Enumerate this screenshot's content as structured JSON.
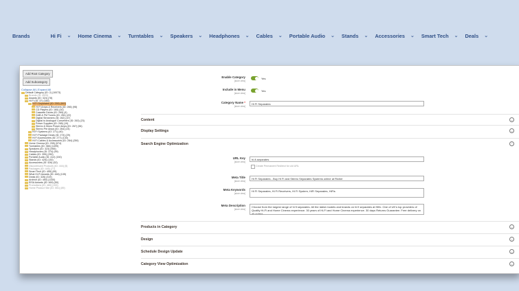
{
  "nav": [
    "Brands",
    "Hi Fi",
    "Home Cinema",
    "Turntables",
    "Speakers",
    "Headphones",
    "Cables",
    "Portable Audio",
    "Stands",
    "Accessories",
    "Smart Tech",
    "Deals"
  ],
  "buttons": {
    "add_root": "Add Root Category",
    "add_sub": "Add Subcategory"
  },
  "tree": {
    "root": "Collapse All | Expand All",
    "nodes": [
      {
        "t": "Default Category (ID: 2) (10073)",
        "lvl": 0
      },
      {
        "t": "Brands (ID: 4525)",
        "lvl": 1,
        "dim": true
      },
      {
        "t": "Awards (ID: 324) (78)",
        "lvl": 1
      },
      {
        "t": "Hi Fi (ID: 37) (346)",
        "lvl": 1
      },
      {
        "t": "Hi Fi Separates (ID: 259) (502)",
        "lvl": 2,
        "sel": true
      },
      {
        "t": "Hi Fi Amps & Receivers (ID: 266) (98)",
        "lvl": 3
      },
      {
        "t": "CD Players (ID: 160) (30)",
        "lvl": 3
      },
      {
        "t": "Cassette Decks (ID: 269) (4)",
        "lvl": 3
      },
      {
        "t": "DAB & FM Tuners (ID: 261) (22)",
        "lvl": 3
      },
      {
        "t": "Digital Streamers (ID: 262) (47)",
        "lvl": 3
      },
      {
        "t": "Digital to Analogue Converters (ID: 263) (23)",
        "lvl": 3
      },
      {
        "t": "Power Supplies (ID: 265) (19)",
        "lvl": 3
      },
      {
        "t": "Stereo & Mono Power Amps (ID: 267) (56)",
        "lvl": 3
      },
      {
        "t": "Stereo Pre Amps (ID: 264) (24)",
        "lvl": 3
      },
      {
        "t": "Hi Fi Systems (ID: 271) (40)",
        "lvl": 2
      },
      {
        "t": "Hi Fi Package Deals (ID: 274) (29)",
        "lvl": 2
      },
      {
        "t": "Hi Fi Accessories (ID: 277) (130)",
        "lvl": 2
      },
      {
        "t": "Hi Fi Cables & Accessories (ID: 284) (250)",
        "lvl": 2
      },
      {
        "t": "Home Cinema (ID: 295) (574)",
        "lvl": 1
      },
      {
        "t": "Turntables (ID: 366) (1499)",
        "lvl": 1
      },
      {
        "t": "Speakers (ID: 323) (955)",
        "lvl": 1
      },
      {
        "t": "Headphones (ID: 374) (99)",
        "lvl": 1
      },
      {
        "t": "Cables (ID: 399) (250)",
        "lvl": 1
      },
      {
        "t": "Portable Audio (ID: 412) (150)",
        "lvl": 1
      },
      {
        "t": "Stands (ID: 425) (130)",
        "lvl": 1
      },
      {
        "t": "Accessories (ID: 426) (52)",
        "lvl": 1
      },
      {
        "t": "Discontinued Products (ID: 444) (5)",
        "lvl": 1,
        "dim": true
      },
      {
        "t": "Packages (ID: 445) (77)",
        "lvl": 1,
        "dim": true
      },
      {
        "t": "Smart Tech (ID: 455) (99)",
        "lvl": 1
      },
      {
        "t": "What Hi-Fi Awards (ID: 446) (135)",
        "lvl": 1
      },
      {
        "t": "Deals (ID: 326) (319)",
        "lvl": 1
      },
      {
        "t": "Archive (ID: 450) (1330)",
        "lvl": 1
      },
      {
        "t": "EISA Awards (ID: 469) (50)",
        "lvl": 1
      },
      {
        "t": "Promotions (ID: 480) (153)",
        "lvl": 1,
        "dim": true
      },
      {
        "t": "Home Product Site (ID: 551) (89)",
        "lvl": 1,
        "dim": true
      }
    ]
  },
  "form": {
    "scope": "[store view]",
    "enable_label": "Enable Category",
    "enable_value": "Yes",
    "menu_label": "Include in Menu",
    "menu_value": "Yes",
    "name_label": "Category Name",
    "name_req": "*",
    "name_value": "Hi Fi Separates",
    "url_label": "URL Key",
    "url_value": "hi-fi-separates",
    "redirect_label": "Create Permanent Redirect for old URL",
    "meta_title_label": "Meta Title",
    "meta_title_value": "Hi Fi Separates - Buy Hi Fi and Stereo Separates Systems online at Richer",
    "meta_kw_label": "Meta Keywords",
    "meta_kw_value": "Hi Fi Separates, Hi Fi Receivers, Hi Fi System, HiFi Separates, HiFis",
    "meta_desc_label": "Meta Description",
    "meta_desc_value": "Choose from the largest range of hi fi separates. All the latest models and brands on hi fi separates at Hifix. One of UK's top providers of Quality Hi-Fi and Home Cinema experience. 30 years of Hi-Fi and Home Cinema experience. 30 days Returns Guarantee. Free delivery on all orders."
  },
  "sections": {
    "content": "Content",
    "display": "Display Settings",
    "seo": "Search Engine Optimization",
    "products": "Products in Category",
    "design": "Design",
    "schedule": "Schedule Design Update",
    "catview": "Category View Optimization"
  },
  "icons": {
    "chevron": "chevron-down-icon",
    "collapse": "circle-chevron-icon",
    "folder": "folder-icon"
  }
}
